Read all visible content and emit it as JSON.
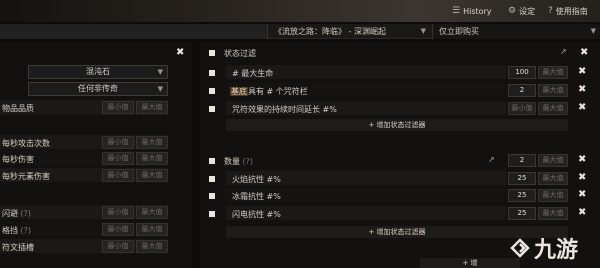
{
  "topbar": {
    "history_label": "History",
    "settings_label": "设定",
    "guide_label": "使用指南"
  },
  "search": {
    "league": "《流放之路：降临》 - 深渊崛起",
    "mode": "仅立即购买"
  },
  "left": {
    "currency": "混沌石",
    "rarity": "任何非传奇",
    "item_level_label": "物品品质",
    "stats": [
      {
        "label": "每秒攻击次数"
      },
      {
        "label": "每秒伤害"
      },
      {
        "label": "每秒元素伤害"
      }
    ],
    "defense": [
      {
        "label": "闪避",
        "q": "(?)"
      },
      {
        "label": "格挡",
        "q": "(?)"
      },
      {
        "label": "符文插槽",
        "q": ""
      }
    ],
    "min_label": "最小值",
    "max_label": "最大值"
  },
  "right": {
    "filter_title": "状态过滤",
    "filters": [
      {
        "prefix": "#",
        "text": "最大生命",
        "min": "100",
        "max": "最大值"
      },
      {
        "hl": "基底",
        "text": "具有 # 个咒符栏",
        "min": "2",
        "max": "最大值"
      },
      {
        "text": "咒符效果的持续时间延长 #%",
        "min": "最小值",
        "max": "最大值"
      }
    ],
    "add_filter": "+ 增加状态过滤器",
    "count_title": "数量",
    "count_q": "(?)",
    "count_min": "2",
    "count_max": "最大值",
    "count_filters": [
      {
        "text": "火焰抗性 #%",
        "min": "25",
        "max": "最大值"
      },
      {
        "text": "冰霜抗性 #%",
        "min": "25",
        "max": "最大值"
      },
      {
        "text": "闪电抗性 #%",
        "min": "25",
        "max": "最大值"
      }
    ],
    "add_filter2": "+ 增加状态过滤器",
    "add_filter3": "+ 增"
  },
  "watermark": {
    "text": "九游"
  }
}
